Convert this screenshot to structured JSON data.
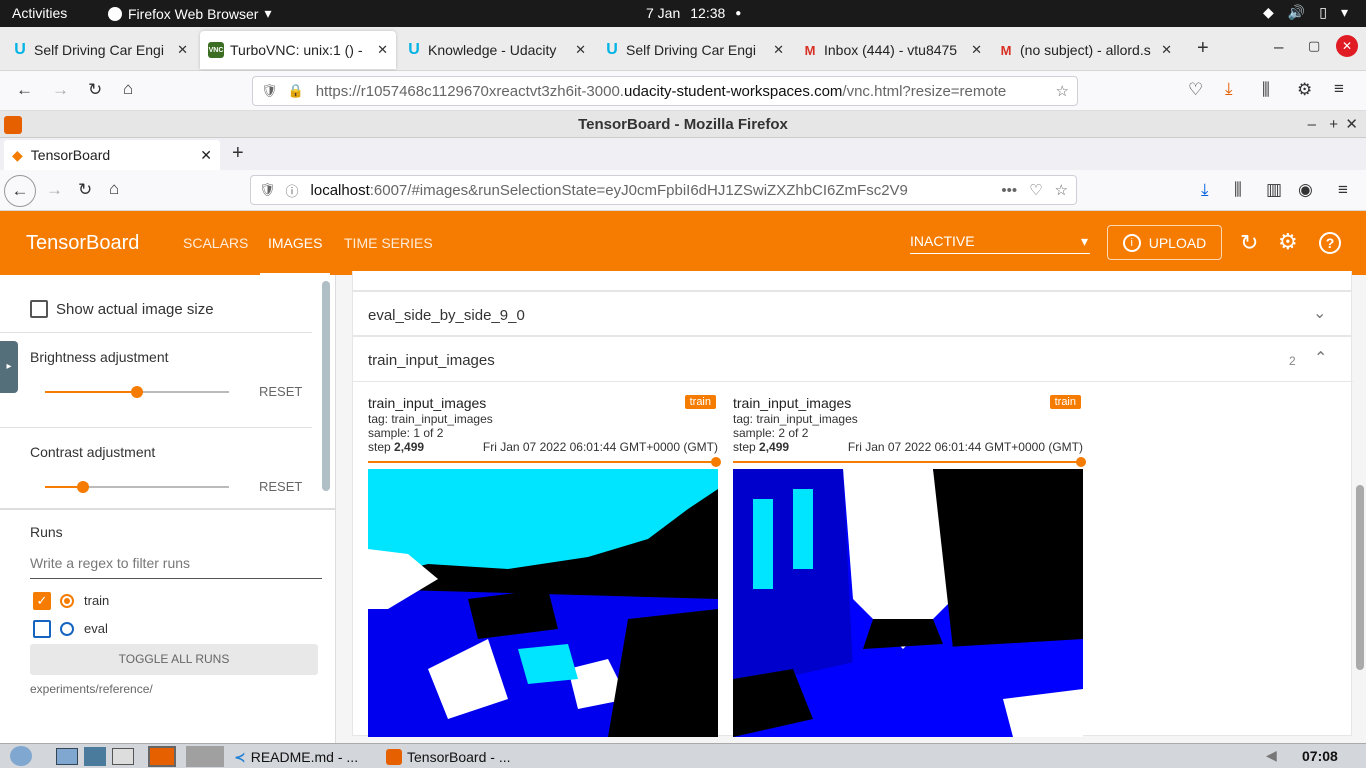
{
  "gnome": {
    "activities": "Activities",
    "app_name": "Firefox Web Browser",
    "date": "7 Jan",
    "time": "12:38"
  },
  "outer_tabs": [
    {
      "label": "Self Driving Car Engi",
      "fav": "U",
      "color": "#02b3e4"
    },
    {
      "label": "TurboVNC: unix:1 () -",
      "fav": "VNC",
      "color": "#3b6e22"
    },
    {
      "label": "Knowledge - Udacity",
      "fav": "U",
      "color": "#02b3e4"
    },
    {
      "label": "Self Driving Car Engi",
      "fav": "U",
      "color": "#02b3e4"
    },
    {
      "label": "Inbox (444) - vtu8475",
      "fav": "M",
      "color": "#d93025"
    },
    {
      "label": "(no subject) - allord.s",
      "fav": "M",
      "color": "#d93025"
    }
  ],
  "outer_url": {
    "prefix": "https://r1057468c1129670xreactvt3zh6it-3000.",
    "domain": "udacity-student-workspaces.com",
    "rest": "/vnc.html?resize=remote"
  },
  "vnc_title": "TensorBoard - Mozilla Firefox",
  "inner_tab": "TensorBoard",
  "inner_url": {
    "host": "localhost",
    "rest": ":6007/#images&runSelectionState=eyJ0cmFpbiI6dHJ1ZSwiZXZhbCI6ZmFsc2V9"
  },
  "tb": {
    "brand": "TensorBoard",
    "tabs": [
      "SCALARS",
      "IMAGES",
      "TIME SERIES"
    ],
    "run_select": "INACTIVE",
    "upload": "UPLOAD"
  },
  "sidebar": {
    "show_actual": "Show actual image size",
    "brightness": "Brightness adjustment",
    "brightness_value": 0.5,
    "contrast": "Contrast adjustment",
    "contrast_value": 0.2,
    "reset": "RESET",
    "runs_title": "Runs",
    "filter_placeholder": "Write a regex to filter runs",
    "runs": [
      {
        "name": "train",
        "checked": true
      },
      {
        "name": "eval",
        "checked": false
      }
    ],
    "toggle_all": "TOGGLE ALL RUNS",
    "logdir": "experiments/reference/"
  },
  "main": {
    "rows": [
      {
        "title": "eval_side_by_side_9_0",
        "count": ""
      },
      {
        "title": "train_input_images",
        "count": "2"
      }
    ],
    "cards": [
      {
        "title": "train_input_images",
        "badge": "train",
        "tag": "tag: train_input_images",
        "sample": "sample: 1 of 2",
        "step_label": "step",
        "step": "2,499",
        "date": "Fri Jan 07 2022 06:01:44 GMT+0000 (GMT)"
      },
      {
        "title": "train_input_images",
        "badge": "train",
        "tag": "tag: train_input_images",
        "sample": "sample: 2 of 2",
        "step_label": "step",
        "step": "2,499",
        "date": "Fri Jan 07 2022 06:01:44 GMT+0000 (GMT)"
      }
    ]
  },
  "panel": {
    "task1": "README.md - ...",
    "task2": "TensorBoard - ...",
    "clock": "07:08"
  }
}
